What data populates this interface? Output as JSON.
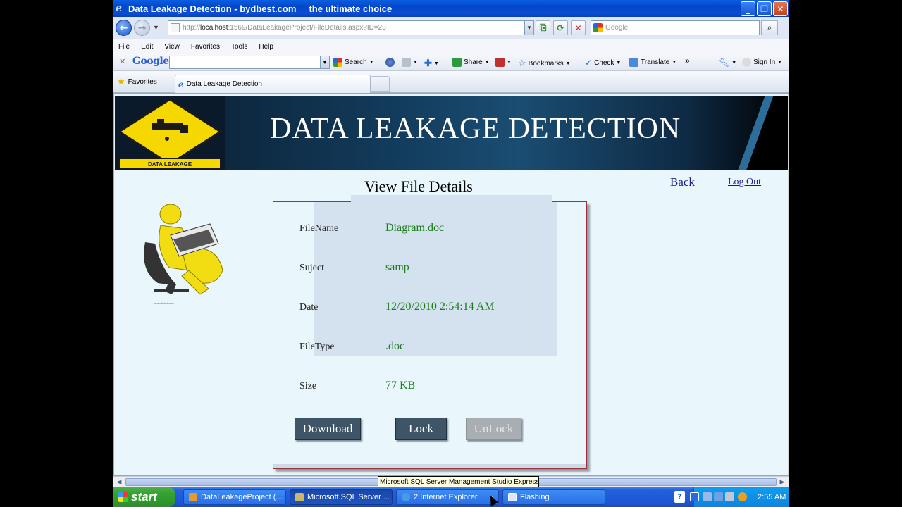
{
  "window": {
    "title": "Data Leakage Detection - bydbest.com     the ultimate choice",
    "controls": [
      "_",
      "❐",
      "✕"
    ]
  },
  "address_bar": {
    "url_prefix": "http://",
    "url_host": "localhost",
    "url_rest": ":1569/DataLeakageProject/FileDetails.aspx?ID=23",
    "search_placeholder": "Google"
  },
  "menu": [
    "File",
    "Edit",
    "View",
    "Favorites",
    "Tools",
    "Help"
  ],
  "google_toolbar": {
    "logo": "Google",
    "buttons": {
      "search": "Search",
      "share": "Share",
      "bookmarks": "Bookmarks",
      "check": "Check",
      "translate": "Translate",
      "more": "»",
      "sign_in": "Sign In"
    }
  },
  "favorites_bar": {
    "favorites_label": "Favorites",
    "tab_title": "Data Leakage Detection"
  },
  "page": {
    "banner_title": "DATA LEAKAGE DETECTION",
    "logo_caption": "DATA LEAKAGE",
    "heading": "View File Details",
    "back_link": "Back",
    "logout_link": "Log Out",
    "details": [
      {
        "label": "FileName",
        "value": "Diagram.doc"
      },
      {
        "label": "Suject",
        "value": "samp"
      },
      {
        "label": "Date",
        "value": "12/20/2010 2:54:14 AM"
      },
      {
        "label": "FileType",
        "value": ".doc"
      },
      {
        "label": "Size",
        "value": "77 KB"
      }
    ],
    "buttons": {
      "download": "Download",
      "lock": "Lock",
      "unlock": "UnLock"
    }
  },
  "tooltip": "Microsoft SQL Server Management Studio Express",
  "taskbar": {
    "start": "start",
    "tasks": [
      {
        "label": "DataLeakageProject (...",
        "active": false
      },
      {
        "label": "Microsoft SQL Server ...",
        "active": true
      },
      {
        "label": "2 Internet Explorer",
        "active": false
      },
      {
        "label": "Flashing",
        "active": false
      }
    ],
    "clock": "2:55 AM"
  },
  "colors": {
    "titlebar": "#0a4ed4",
    "page_bg": "#e9f6fb",
    "value_green": "#1b7d1b",
    "button_dark": "#3d5567",
    "card_border": "#a0303a"
  }
}
